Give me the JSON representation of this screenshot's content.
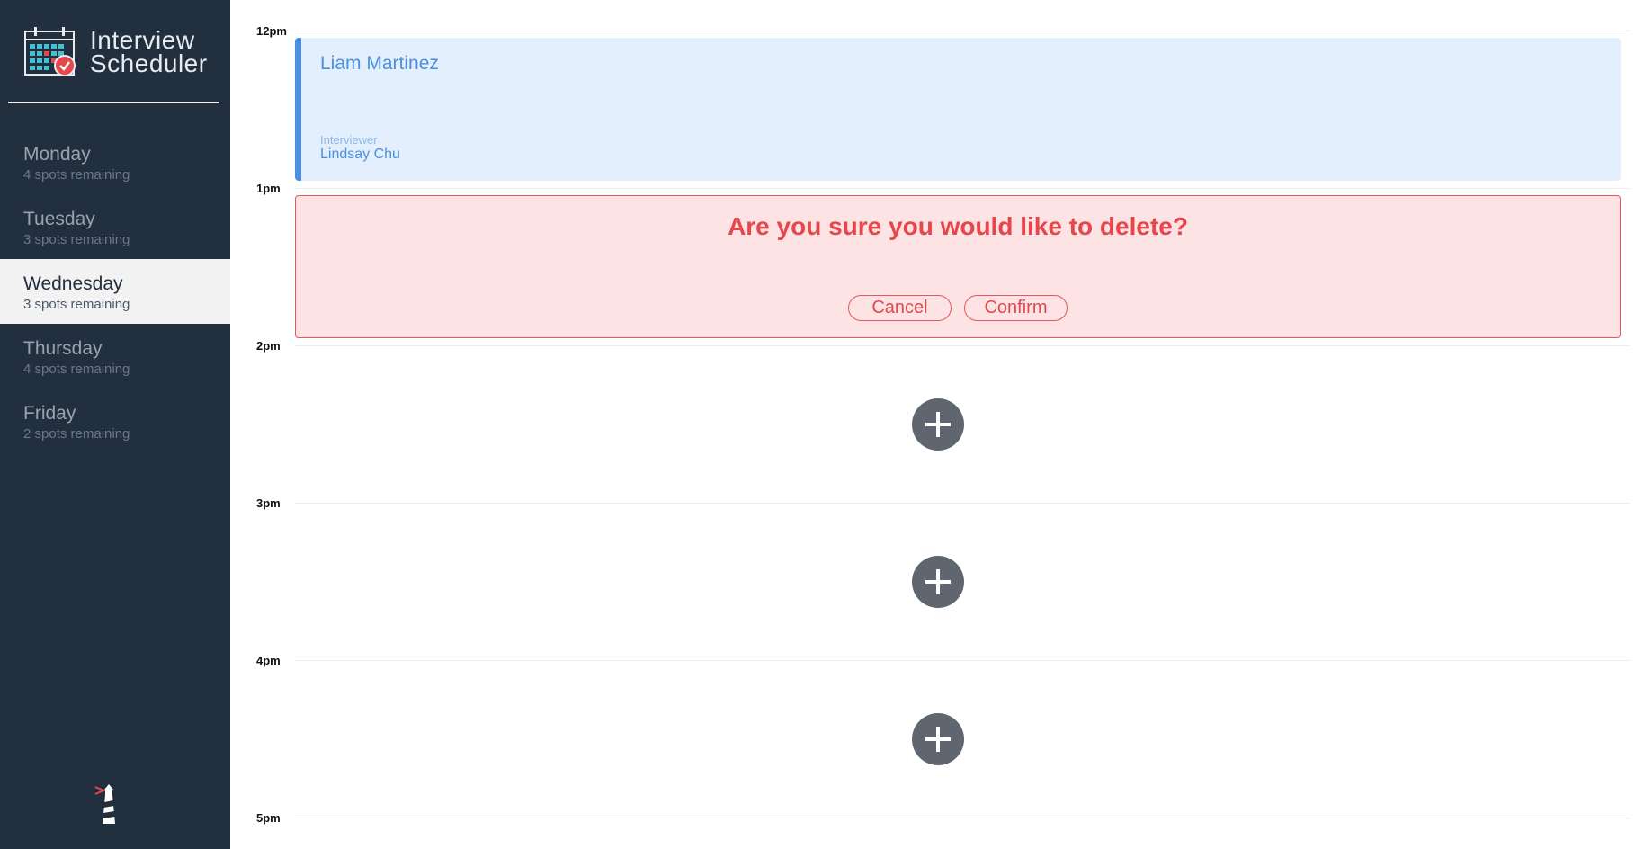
{
  "app": {
    "title_line1": "Interview",
    "title_line2": "Scheduler"
  },
  "sidebar": {
    "days": [
      {
        "name": "Monday",
        "spots": "4 spots remaining",
        "selected": false
      },
      {
        "name": "Tuesday",
        "spots": "3 spots remaining",
        "selected": false
      },
      {
        "name": "Wednesday",
        "spots": "3 spots remaining",
        "selected": true
      },
      {
        "name": "Thursday",
        "spots": "4 spots remaining",
        "selected": false
      },
      {
        "name": "Friday",
        "spots": "2 spots remaining",
        "selected": false
      }
    ]
  },
  "schedule": {
    "times": [
      "12pm",
      "1pm",
      "2pm",
      "3pm",
      "4pm",
      "5pm"
    ],
    "appointment": {
      "student": "Liam Martinez",
      "interviewer_label": "Interviewer",
      "interviewer": "Lindsay Chu"
    },
    "confirm": {
      "message": "Are you sure you would like to delete?",
      "cancel_label": "Cancel",
      "confirm_label": "Confirm"
    }
  },
  "colors": {
    "sidebar_bg": "#222f3e",
    "accent_blue": "#4a90e2",
    "danger_red": "#e5474b",
    "add_button": "#5f6670"
  },
  "icons": {
    "brand": "calendar-check-icon",
    "footer": "lighthouse-icon",
    "add": "plus-icon"
  }
}
